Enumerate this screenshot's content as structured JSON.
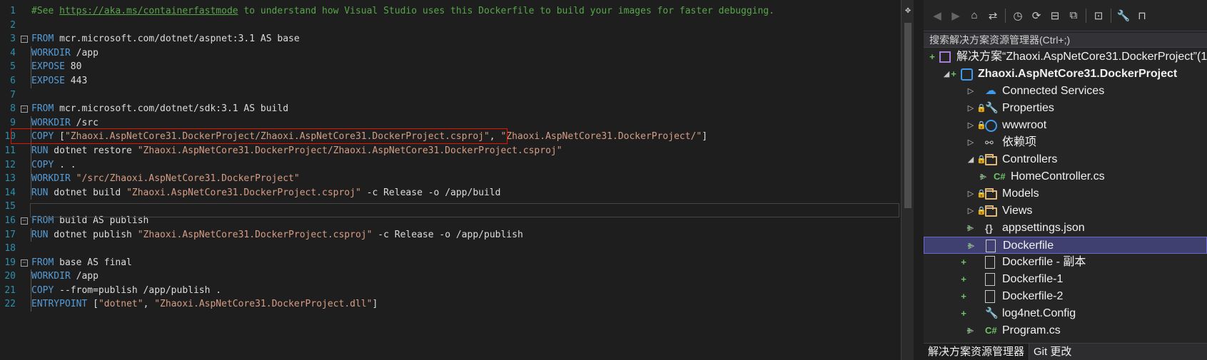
{
  "editor": {
    "line_numbers": [
      "1",
      "2",
      "3",
      "4",
      "5",
      "6",
      "7",
      "8",
      "9",
      "10",
      "11",
      "12",
      "13",
      "14",
      "15",
      "16",
      "17",
      "18",
      "19",
      "20",
      "21",
      "22"
    ],
    "lines": [
      {
        "fold": false,
        "guide": false,
        "tokens": [
          {
            "c": "cm",
            "t": "#See "
          },
          {
            "c": "url",
            "t": "https://aka.ms/containerfastmode"
          },
          {
            "c": "cm",
            "t": " to understand how Visual Studio uses this Dockerfile to build your images for faster debugging."
          }
        ]
      },
      {
        "fold": false,
        "guide": false,
        "tokens": []
      },
      {
        "fold": true,
        "guide": false,
        "tokens": [
          {
            "c": "kw",
            "t": "FROM"
          },
          {
            "c": "pl",
            "t": " mcr.microsoft.com/dotnet/aspnet:3.1 AS base"
          }
        ]
      },
      {
        "fold": false,
        "guide": true,
        "tokens": [
          {
            "c": "kw",
            "t": "WORKDIR"
          },
          {
            "c": "pl",
            "t": " /app"
          }
        ]
      },
      {
        "fold": false,
        "guide": true,
        "tokens": [
          {
            "c": "kw",
            "t": "EXPOSE"
          },
          {
            "c": "pl",
            "t": " 80"
          }
        ]
      },
      {
        "fold": false,
        "guide": true,
        "tokens": [
          {
            "c": "kw",
            "t": "EXPOSE"
          },
          {
            "c": "pl",
            "t": " 443"
          }
        ]
      },
      {
        "fold": false,
        "guide": false,
        "tokens": []
      },
      {
        "fold": true,
        "guide": false,
        "tokens": [
          {
            "c": "kw",
            "t": "FROM"
          },
          {
            "c": "pl",
            "t": " mcr.microsoft.com/dotnet/sdk:3.1 AS build"
          }
        ]
      },
      {
        "fold": false,
        "guide": true,
        "tokens": [
          {
            "c": "kw",
            "t": "WORKDIR"
          },
          {
            "c": "pl",
            "t": " /src"
          }
        ]
      },
      {
        "fold": false,
        "guide": true,
        "tokens": [
          {
            "c": "kw",
            "t": "COPY"
          },
          {
            "c": "pl",
            "t": " ["
          },
          {
            "c": "str",
            "t": "\"Zhaoxi.AspNetCore31.DockerProject/Zhaoxi.AspNetCore31.DockerProject.csproj\""
          },
          {
            "c": "pl",
            "t": ", "
          },
          {
            "c": "str",
            "t": "\"Zhaoxi.AspNetCore31.DockerProject/\""
          },
          {
            "c": "pl",
            "t": "]"
          }
        ]
      },
      {
        "fold": false,
        "guide": true,
        "tokens": [
          {
            "c": "kw",
            "t": "RUN"
          },
          {
            "c": "pl",
            "t": " dotnet restore "
          },
          {
            "c": "str",
            "t": "\"Zhaoxi.AspNetCore31.DockerProject/Zhaoxi.AspNetCore31.DockerProject.csproj\""
          }
        ]
      },
      {
        "fold": false,
        "guide": true,
        "tokens": [
          {
            "c": "kw",
            "t": "COPY"
          },
          {
            "c": "pl",
            "t": " . ."
          }
        ]
      },
      {
        "fold": false,
        "guide": true,
        "tokens": [
          {
            "c": "kw",
            "t": "WORKDIR"
          },
          {
            "c": "pl",
            "t": " "
          },
          {
            "c": "str",
            "t": "\"/src/Zhaoxi.AspNetCore31.DockerProject\""
          }
        ]
      },
      {
        "fold": false,
        "guide": true,
        "tokens": [
          {
            "c": "kw",
            "t": "RUN"
          },
          {
            "c": "pl",
            "t": " dotnet build "
          },
          {
            "c": "str",
            "t": "\"Zhaoxi.AspNetCore31.DockerProject.csproj\""
          },
          {
            "c": "pl",
            "t": " -c Release -o /app/build"
          }
        ]
      },
      {
        "fold": false,
        "guide": false,
        "tokens": []
      },
      {
        "fold": true,
        "guide": false,
        "tokens": [
          {
            "c": "kw",
            "t": "FROM"
          },
          {
            "c": "pl",
            "t": " build AS publish"
          }
        ]
      },
      {
        "fold": false,
        "guide": true,
        "tokens": [
          {
            "c": "kw",
            "t": "RUN"
          },
          {
            "c": "pl",
            "t": " dotnet publish "
          },
          {
            "c": "str",
            "t": "\"Zhaoxi.AspNetCore31.DockerProject.csproj\""
          },
          {
            "c": "pl",
            "t": " -c Release -o /app/publish"
          }
        ]
      },
      {
        "fold": false,
        "guide": false,
        "tokens": []
      },
      {
        "fold": true,
        "guide": false,
        "tokens": [
          {
            "c": "kw",
            "t": "FROM"
          },
          {
            "c": "pl",
            "t": " base AS final"
          }
        ]
      },
      {
        "fold": false,
        "guide": true,
        "tokens": [
          {
            "c": "kw",
            "t": "WORKDIR"
          },
          {
            "c": "pl",
            "t": " /app"
          }
        ]
      },
      {
        "fold": false,
        "guide": true,
        "tokens": [
          {
            "c": "kw",
            "t": "COPY"
          },
          {
            "c": "pl",
            "t": " --from=publish /app/publish ."
          }
        ]
      },
      {
        "fold": false,
        "guide": true,
        "tokens": [
          {
            "c": "kw",
            "t": "ENTRYPOINT"
          },
          {
            "c": "pl",
            "t": " ["
          },
          {
            "c": "str",
            "t": "\"dotnet\""
          },
          {
            "c": "pl",
            "t": ", "
          },
          {
            "c": "str",
            "t": "\"Zhaoxi.AspNetCore31.DockerProject.dll\""
          },
          {
            "c": "pl",
            "t": "]"
          }
        ]
      }
    ]
  },
  "solution_explorer": {
    "search_placeholder": "搜索解决方案资源管理器(Ctrl+;)",
    "items": [
      {
        "label": "解决方案“Zhaoxi.AspNetCore31.DockerProject”(1",
        "icon": "solution-icon",
        "indent": 0,
        "expander": "",
        "plus": true,
        "lock": false,
        "bold": false,
        "selected": false
      },
      {
        "label": "Zhaoxi.AspNetCore31.DockerProject",
        "icon": "project-icon",
        "indent": 1,
        "expander": "◢",
        "plus": true,
        "lock": false,
        "bold": true,
        "selected": false
      },
      {
        "label": "Connected Services",
        "icon": "cloud-icon",
        "indent": 2,
        "expander": "▷",
        "plus": false,
        "lock": false,
        "bold": false,
        "selected": false
      },
      {
        "label": "Properties",
        "icon": "wrench-icon",
        "indent": 2,
        "expander": "▷",
        "plus": false,
        "lock": true,
        "bold": false,
        "selected": false
      },
      {
        "label": "wwwroot",
        "icon": "globe-icon",
        "indent": 2,
        "expander": "▷",
        "plus": false,
        "lock": true,
        "bold": false,
        "selected": false
      },
      {
        "label": "依赖项",
        "icon": "dependencies-icon",
        "indent": 2,
        "expander": "▷",
        "plus": false,
        "lock": false,
        "bold": false,
        "selected": false
      },
      {
        "label": "Controllers",
        "icon": "folder-icon",
        "indent": 2,
        "expander": "◢",
        "plus": false,
        "lock": true,
        "bold": false,
        "selected": false
      },
      {
        "label": "HomeController.cs",
        "icon": "csharp-icon",
        "indent": 3,
        "expander": "▷",
        "plus": true,
        "lock": false,
        "bold": false,
        "selected": false
      },
      {
        "label": "Models",
        "icon": "folder-icon",
        "indent": 2,
        "expander": "▷",
        "plus": false,
        "lock": true,
        "bold": false,
        "selected": false
      },
      {
        "label": "Views",
        "icon": "folder-icon",
        "indent": 2,
        "expander": "▷",
        "plus": false,
        "lock": true,
        "bold": false,
        "selected": false
      },
      {
        "label": "appsettings.json",
        "icon": "json-icon",
        "indent": 2,
        "expander": "▷",
        "plus": true,
        "lock": false,
        "bold": false,
        "selected": false
      },
      {
        "label": "Dockerfile",
        "icon": "file-icon",
        "indent": 2,
        "expander": "▷",
        "plus": true,
        "lock": false,
        "bold": false,
        "selected": true
      },
      {
        "label": "Dockerfile - 副本",
        "icon": "file-icon",
        "indent": 2,
        "expander": "",
        "plus": true,
        "lock": false,
        "bold": false,
        "selected": false
      },
      {
        "label": "Dockerfile-1",
        "icon": "file-icon",
        "indent": 2,
        "expander": "",
        "plus": true,
        "lock": false,
        "bold": false,
        "selected": false
      },
      {
        "label": "Dockerfile-2",
        "icon": "file-icon",
        "indent": 2,
        "expander": "",
        "plus": true,
        "lock": false,
        "bold": false,
        "selected": false
      },
      {
        "label": "log4net.Config",
        "icon": "config-icon",
        "indent": 2,
        "expander": "",
        "plus": true,
        "lock": false,
        "bold": false,
        "selected": false
      },
      {
        "label": "Program.cs",
        "icon": "csharp-icon",
        "indent": 2,
        "expander": "▷",
        "plus": true,
        "lock": false,
        "bold": false,
        "selected": false
      }
    ],
    "tabs": [
      {
        "label": "解决方案资源管理器",
        "active": true
      },
      {
        "label": "Git 更改",
        "active": false
      }
    ]
  },
  "colors": {
    "keyword": "#569cd6",
    "comment": "#57a64a",
    "string": "#d69d85",
    "highlight_box": "#e51400",
    "selection": "#3f3f70"
  }
}
